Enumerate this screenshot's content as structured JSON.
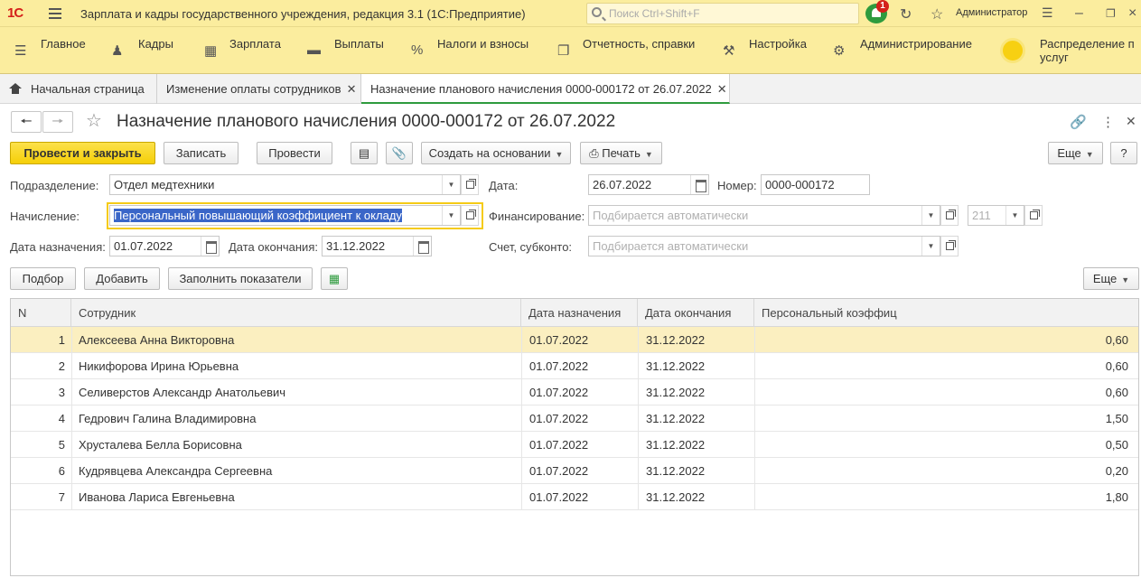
{
  "app": {
    "logo": "1С",
    "title": "Зарплата и кадры государственного учреждения, редакция 3.1  (1С:Предприятие)",
    "search_placeholder": "Поиск Ctrl+Shift+F",
    "notifications_count": "1",
    "user": "Администратор"
  },
  "menu": [
    "Главное",
    "Кадры",
    "Зарплата",
    "Выплаты",
    "Налоги и взносы",
    "Отчетность, справки",
    "Настройка",
    "Администрирование",
    "Распределение п",
    "услуг"
  ],
  "tabs": [
    "Начальная страница",
    "Изменение оплаты сотрудников",
    "Назначение планового начисления 0000-000172 от 26.07.2022"
  ],
  "document": {
    "title": "Назначение планового начисления 0000-000172 от 26.07.2022"
  },
  "toolbar": {
    "post_close": "Провести и закрыть",
    "save": "Записать",
    "post": "Провести",
    "create_based": "Создать на основании",
    "print": "Печать",
    "more": "Еще",
    "help": "?"
  },
  "form": {
    "department_label": "Подразделение:",
    "department": "Отдел медтехники",
    "date_label": "Дата:",
    "date": "26.07.2022",
    "number_label": "Номер:",
    "number": "0000-000172",
    "accrual_label": "Начисление:",
    "accrual": "Персональный повышающий коэффициент к окладу",
    "financing_label": "Финансирование:",
    "financing_placeholder": "Подбирается автоматически",
    "financing_code": "211",
    "start_label": "Дата назначения:",
    "start": "01.07.2022",
    "end_label": "Дата окончания:",
    "end": "31.12.2022",
    "account_label": "Счет, субконто:",
    "account_placeholder": "Подбирается автоматически"
  },
  "table_toolbar": {
    "pick": "Подбор",
    "add": "Добавить",
    "fill": "Заполнить показатели",
    "more": "Еще"
  },
  "table": {
    "headers": [
      "N",
      "Сотрудник",
      "Дата назначения",
      "Дата окончания",
      "Персональный коэффиц"
    ],
    "rows": [
      [
        "1",
        "Алексеева Анна Викторовна",
        "01.07.2022",
        "31.12.2022",
        "0,60"
      ],
      [
        "2",
        "Никифорова Ирина Юрьевна",
        "01.07.2022",
        "31.12.2022",
        "0,60"
      ],
      [
        "3",
        "Селиверстов Александр Анатольевич",
        "01.07.2022",
        "31.12.2022",
        "0,60"
      ],
      [
        "4",
        "Гедрович Галина Владимировна",
        "01.07.2022",
        "31.12.2022",
        "1,50"
      ],
      [
        "5",
        "Хрусталева Белла Борисовна",
        "01.07.2022",
        "31.12.2022",
        "0,50"
      ],
      [
        "6",
        "Кудрявцева Александра Сергеевна",
        "01.07.2022",
        "31.12.2022",
        "0,20"
      ],
      [
        "7",
        "Иванова Лариса Евгеньевна",
        "01.07.2022",
        "31.12.2022",
        "1,80"
      ]
    ]
  }
}
